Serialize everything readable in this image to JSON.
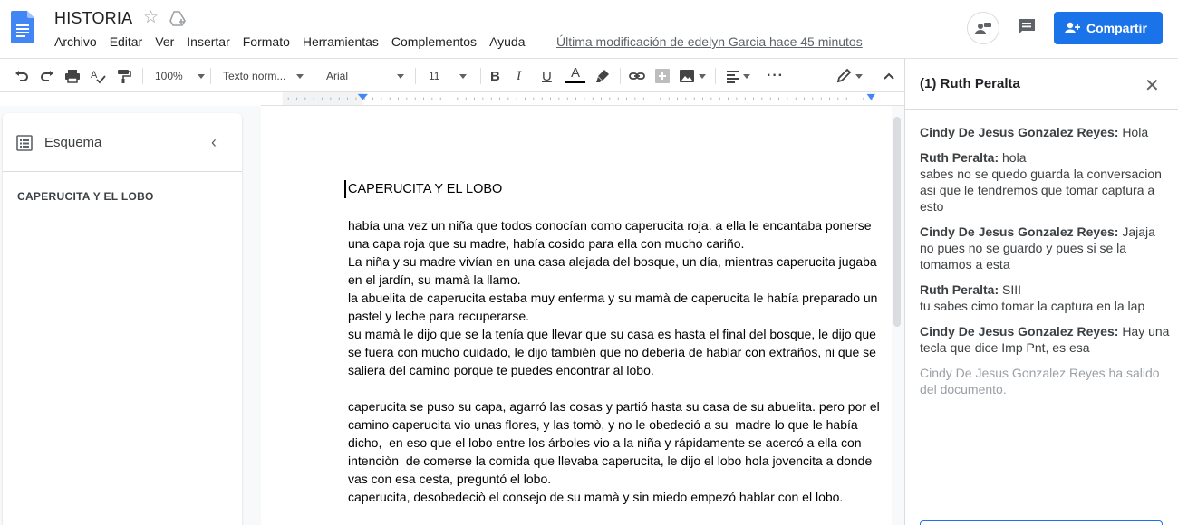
{
  "header": {
    "doc_title": "HISTORIA",
    "menu": [
      "Archivo",
      "Editar",
      "Ver",
      "Insertar",
      "Formato",
      "Herramientas",
      "Complementos",
      "Ayuda"
    ],
    "last_edit": "Última modificación de edelyn Garcia hace 45 minutos",
    "share_label": "Compartir",
    "accent": "#1a73e8"
  },
  "toolbar": {
    "zoom": "100%",
    "style": "Texto norm...",
    "font": "Arial",
    "size": "11"
  },
  "outline": {
    "title": "Esquema",
    "items": [
      "CAPERUCITA Y EL LOBO"
    ]
  },
  "document": {
    "title": "CAPERUCITA Y EL LOBO",
    "paragraphs": [
      "había una vez un niña que todos conocían como caperucita roja. a ella le encantaba ponerse una capa roja que su madre, había cosido para ella con mucho cariño.",
      "La niña y su madre vivían en una casa alejada del bosque, un día, mientras caperucita jugaba en el jardín, su mamà la llamo.",
      "la abuelita de caperucita estaba muy enferma y su mamà de caperucita le había preparado un pastel y leche para recuperarse.",
      "su mamà le dijo que se la tenía que llevar que su casa es hasta el final del bosque, le dijo que se fuera con mucho cuidado, le dijo también que no debería de hablar con extraños, ni que se saliera del camino porque te puedes encontrar al lobo.",
      "",
      "caperucita se puso su capa, agarró las cosas y partió hasta su casa de su abuelita. pero por el camino caperucita vio unas flores, y las tomò, y no le obedeció a su  madre lo que le había dicho,  en eso que el lobo entre los árboles vio a la niña y rápidamente se acercó a ella con intenciòn  de comerse la comida que llevaba caperucita, le dijo el lobo hola jovencita a donde vas con esa cesta, preguntó el lobo.",
      "caperucita, desobedeciò el consejo de su mamà y sin miedo empezó hablar con el lobo."
    ]
  },
  "chat": {
    "title": "(1) Ruth Peralta",
    "messages": [
      {
        "sender": "Cindy De Jesus Gonzalez Reyes:",
        "lines": [
          "Hola"
        ]
      },
      {
        "sender": "Ruth Peralta:",
        "lines": [
          "hola",
          "sabes no se quedo guarda la conversacion",
          "asi que le tendremos que tomar captura a esto"
        ]
      },
      {
        "sender": "Cindy De Jesus Gonzalez Reyes:",
        "lines": [
          "Jajaja",
          "no pues no se guardo y pues si se la tomamos a esta"
        ]
      },
      {
        "sender": "Ruth Peralta:",
        "lines": [
          "SIII",
          "tu sabes cimo tomar la captura en la lap"
        ]
      },
      {
        "sender": "Cindy De Jesus Gonzalez Reyes:",
        "lines": [
          "Hay una tecla que dice Imp Pnt, es esa"
        ]
      }
    ],
    "system_message": "Cindy De Jesus Gonzalez Reyes ha salido del documento."
  }
}
